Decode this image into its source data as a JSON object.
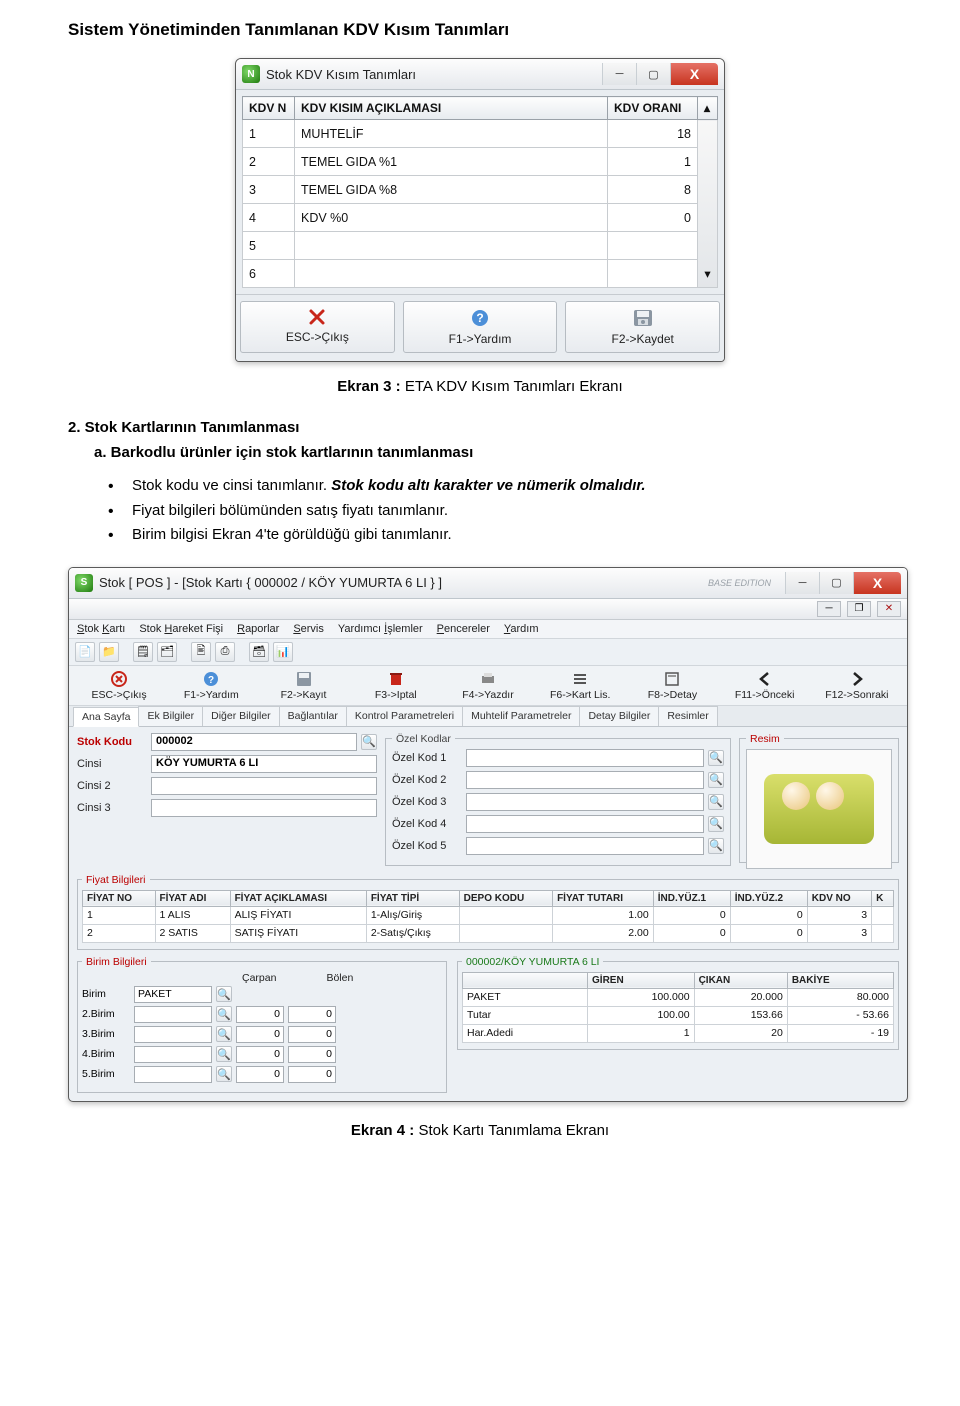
{
  "doc": {
    "heading": "Sistem Yönetiminden Tanımlanan KDV Kısım Tanımları",
    "caption1_bold": "Ekran 3 :",
    "caption1_rest": " ETA KDV Kısım Tanımları Ekranı",
    "section2": "2. Stok Kartlarının Tanımlanması",
    "sub_a": "a. Barkodlu ürünler için stok kartlarının tanımlanması",
    "bullets": {
      "b1_prefix": "Stok kodu ve cinsi tanımlanır. ",
      "b1_bold": "Stok kodu altı karakter ve nümerik olmalıdır.",
      "b2": "Fiyat bilgileri bölümünden satış fiyatı tanımlanır.",
      "b3": "Birim bilgisi Ekran 4'te görüldüğü gibi tanımlanır."
    },
    "caption2_bold": "Ekran 4 :",
    "caption2_rest": " Stok Kartı Tanımlama Ekranı"
  },
  "kdv": {
    "title": "Stok KDV Kısım Tanımları",
    "cols": {
      "c1": "KDV N",
      "c2": "KDV KISIM AÇIKLAMASI",
      "c3": "KDV ORANI"
    },
    "rows": [
      {
        "n": "1",
        "d": "MUHTELİF",
        "o": "18"
      },
      {
        "n": "2",
        "d": "TEMEL GIDA %1",
        "o": "1"
      },
      {
        "n": "3",
        "d": "TEMEL GIDA %8",
        "o": "8"
      },
      {
        "n": "4",
        "d": "KDV %0",
        "o": "0"
      },
      {
        "n": "5",
        "d": "",
        "o": ""
      },
      {
        "n": "6",
        "d": "",
        "o": ""
      }
    ],
    "btns": {
      "esc": "ESC->Çıkış",
      "f1": "F1->Yardım",
      "f2": "F2->Kaydet"
    }
  },
  "stok": {
    "title": "Stok [ POS ] - [Stok Kartı { 000002 / KÖY YUMURTA 6 LI } ]",
    "edition": "BASE EDITION",
    "menu": [
      "Stok Kartı",
      "Stok Hareket Fişi",
      "Raporlar",
      "Servis",
      "Yardımcı İşlemler",
      "Pencereler",
      "Yardım"
    ],
    "func": [
      {
        "l": "ESC->Çıkış"
      },
      {
        "l": "F1->Yardım"
      },
      {
        "l": "F2->Kayıt"
      },
      {
        "l": "F3->Iptal"
      },
      {
        "l": "F4->Yazdır"
      },
      {
        "l": "F6->Kart Lis."
      },
      {
        "l": "F8->Detay"
      },
      {
        "l": "F11->Önceki"
      },
      {
        "l": "F12->Sonraki"
      }
    ],
    "tabs": [
      "Ana Sayfa",
      "Ek Bilgiler",
      "Diğer Bilgiler",
      "Bağlantılar",
      "Kontrol Parametreleri",
      "Muhtelif Parametreler",
      "Detay Bilgiler",
      "Resimler"
    ],
    "ozel_kodlar_legend": "Özel Kodlar",
    "resim_legend": "Resim",
    "fields": {
      "stok_kodu_lbl": "Stok Kodu",
      "stok_kodu": "000002",
      "cinsi_lbl": "Cinsi",
      "cinsi": "KÖY YUMURTA 6 LI",
      "cinsi2_lbl": "Cinsi 2",
      "cinsi3_lbl": "Cinsi 3",
      "ok1": "Özel Kod 1",
      "ok2": "Özel Kod 2",
      "ok3": "Özel Kod 3",
      "ok4": "Özel Kod 4",
      "ok5": "Özel Kod 5"
    },
    "fiyat_legend": "Fiyat Bilgileri",
    "fiyat_cols": [
      "FİYAT NO",
      "FİYAT ADI",
      "FİYAT AÇIKLAMASI",
      "FİYAT TİPİ",
      "DEPO KODU",
      "FİYAT TUTARI",
      "İND.YÜZ.1",
      "İND.YÜZ.2",
      "KDV NO",
      "K"
    ],
    "fiyat_rows": [
      {
        "no": "1",
        "adi": "1 ALIS",
        "acik": "ALIŞ FİYATI",
        "tip": "1-Alış/Giriş",
        "depo": "",
        "tutar": "1.00",
        "i1": "0",
        "i2": "0",
        "kdv": "3",
        "k": ""
      },
      {
        "no": "2",
        "adi": "2 SATIS",
        "acik": "SATIŞ FİYATI",
        "tip": "2-Satış/Çıkış",
        "depo": "",
        "tutar": "2.00",
        "i1": "0",
        "i2": "0",
        "kdv": "3",
        "k": ""
      }
    ],
    "birim_legend": "Birim Bilgileri",
    "birim_head": {
      "carpan": "Çarpan",
      "bolen": "Bölen"
    },
    "birim_rows": [
      {
        "l": "Birim",
        "v": "PAKET",
        "c": "",
        "b": ""
      },
      {
        "l": "2.Birim",
        "v": "",
        "c": "0",
        "b": "0"
      },
      {
        "l": "3.Birim",
        "v": "",
        "c": "0",
        "b": "0"
      },
      {
        "l": "4.Birim",
        "v": "",
        "c": "0",
        "b": "0"
      },
      {
        "l": "5.Birim",
        "v": "",
        "c": "0",
        "b": "0"
      }
    ],
    "summary_title": "000002/KÖY YUMURTA 6 LI",
    "summary_cols": [
      "",
      "GİREN",
      "ÇIKAN",
      "BAKİYE"
    ],
    "summary_rows": [
      {
        "l": "PAKET",
        "g": "100.000",
        "c": "20.000",
        "b": "80.000"
      },
      {
        "l": "Tutar",
        "g": "100.00",
        "c": "153.66",
        "b": "-   53.66"
      },
      {
        "l": "Har.Adedi",
        "g": "1",
        "c": "20",
        "b": "-   19"
      }
    ]
  }
}
